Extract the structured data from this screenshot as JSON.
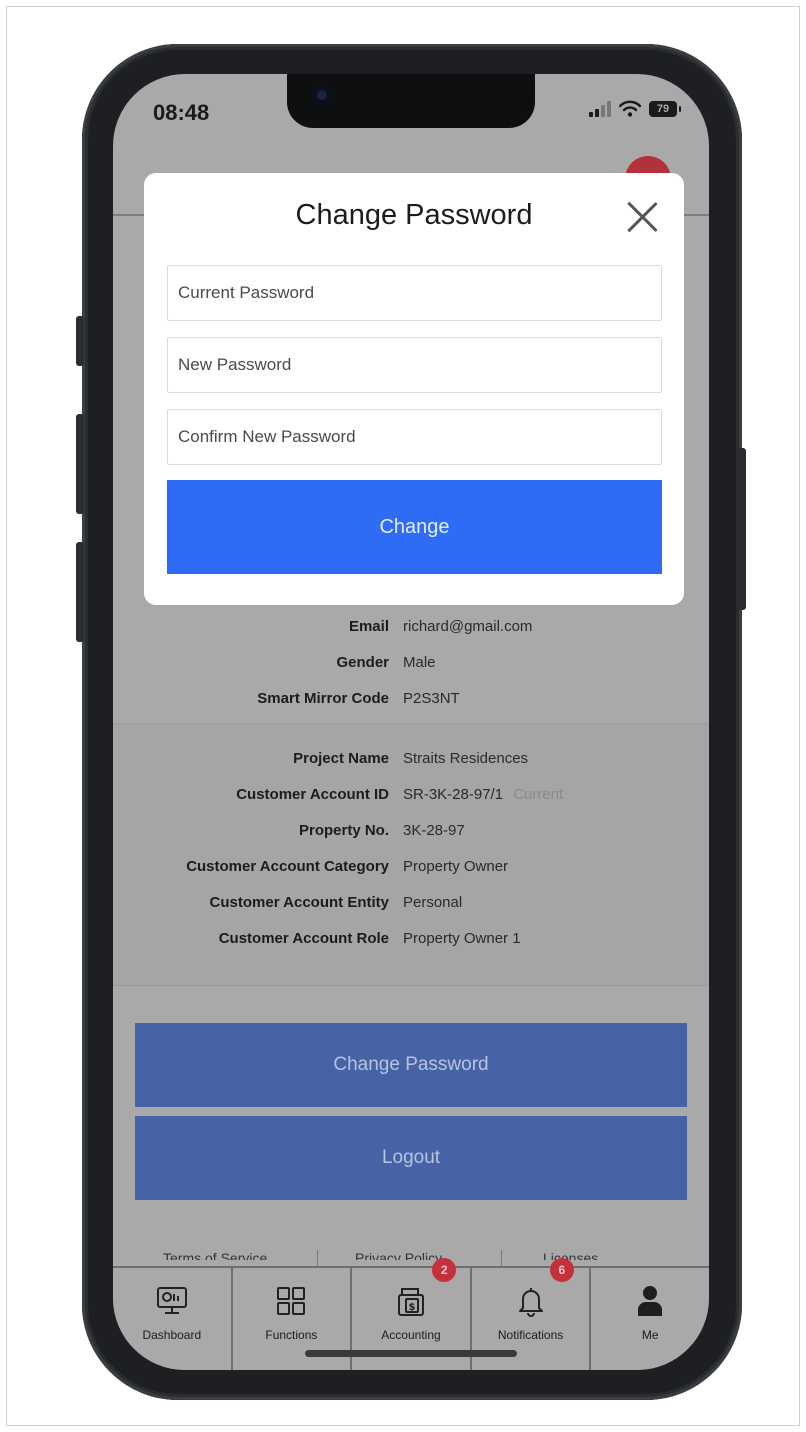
{
  "status_bar": {
    "time": "08:48",
    "battery": "79"
  },
  "modal": {
    "title": "Change Password",
    "fields": [
      {
        "placeholder": "Current Password"
      },
      {
        "placeholder": "New Password"
      },
      {
        "placeholder": "Confirm New Password"
      }
    ],
    "submit_label": "Change"
  },
  "profile": {
    "rows": [
      {
        "key": "Email",
        "value": "richard@gmail.com"
      },
      {
        "key": "Gender",
        "value": "Male"
      },
      {
        "key": "Smart Mirror Code",
        "value": "P2S3NT"
      }
    ]
  },
  "account": {
    "rows": [
      {
        "key": "Project Name",
        "value": "Straits Residences"
      },
      {
        "key": "Customer Account ID",
        "value": "SR-3K-28-97/1",
        "tag": "Current"
      },
      {
        "key": "Property No.",
        "value": "3K-28-97"
      },
      {
        "key": "Customer Account Category",
        "value": "Property Owner"
      },
      {
        "key": "Customer Account Entity",
        "value": "Personal"
      },
      {
        "key": "Customer Account Role",
        "value": "Property Owner 1"
      }
    ]
  },
  "actions": {
    "change_password_label": "Change Password",
    "logout_label": "Logout"
  },
  "footer": {
    "links": [
      "Terms of Service",
      "Privacy Policy",
      "Licenses"
    ]
  },
  "tabbar": {
    "tabs": [
      {
        "label": "Dashboard",
        "icon": "dashboard-icon"
      },
      {
        "label": "Functions",
        "icon": "grid-icon"
      },
      {
        "label": "Accounting",
        "icon": "accounting-icon",
        "badge": "2"
      },
      {
        "label": "Notifications",
        "icon": "bell-icon",
        "badge": "6"
      },
      {
        "label": "Me",
        "icon": "user-icon"
      }
    ]
  }
}
